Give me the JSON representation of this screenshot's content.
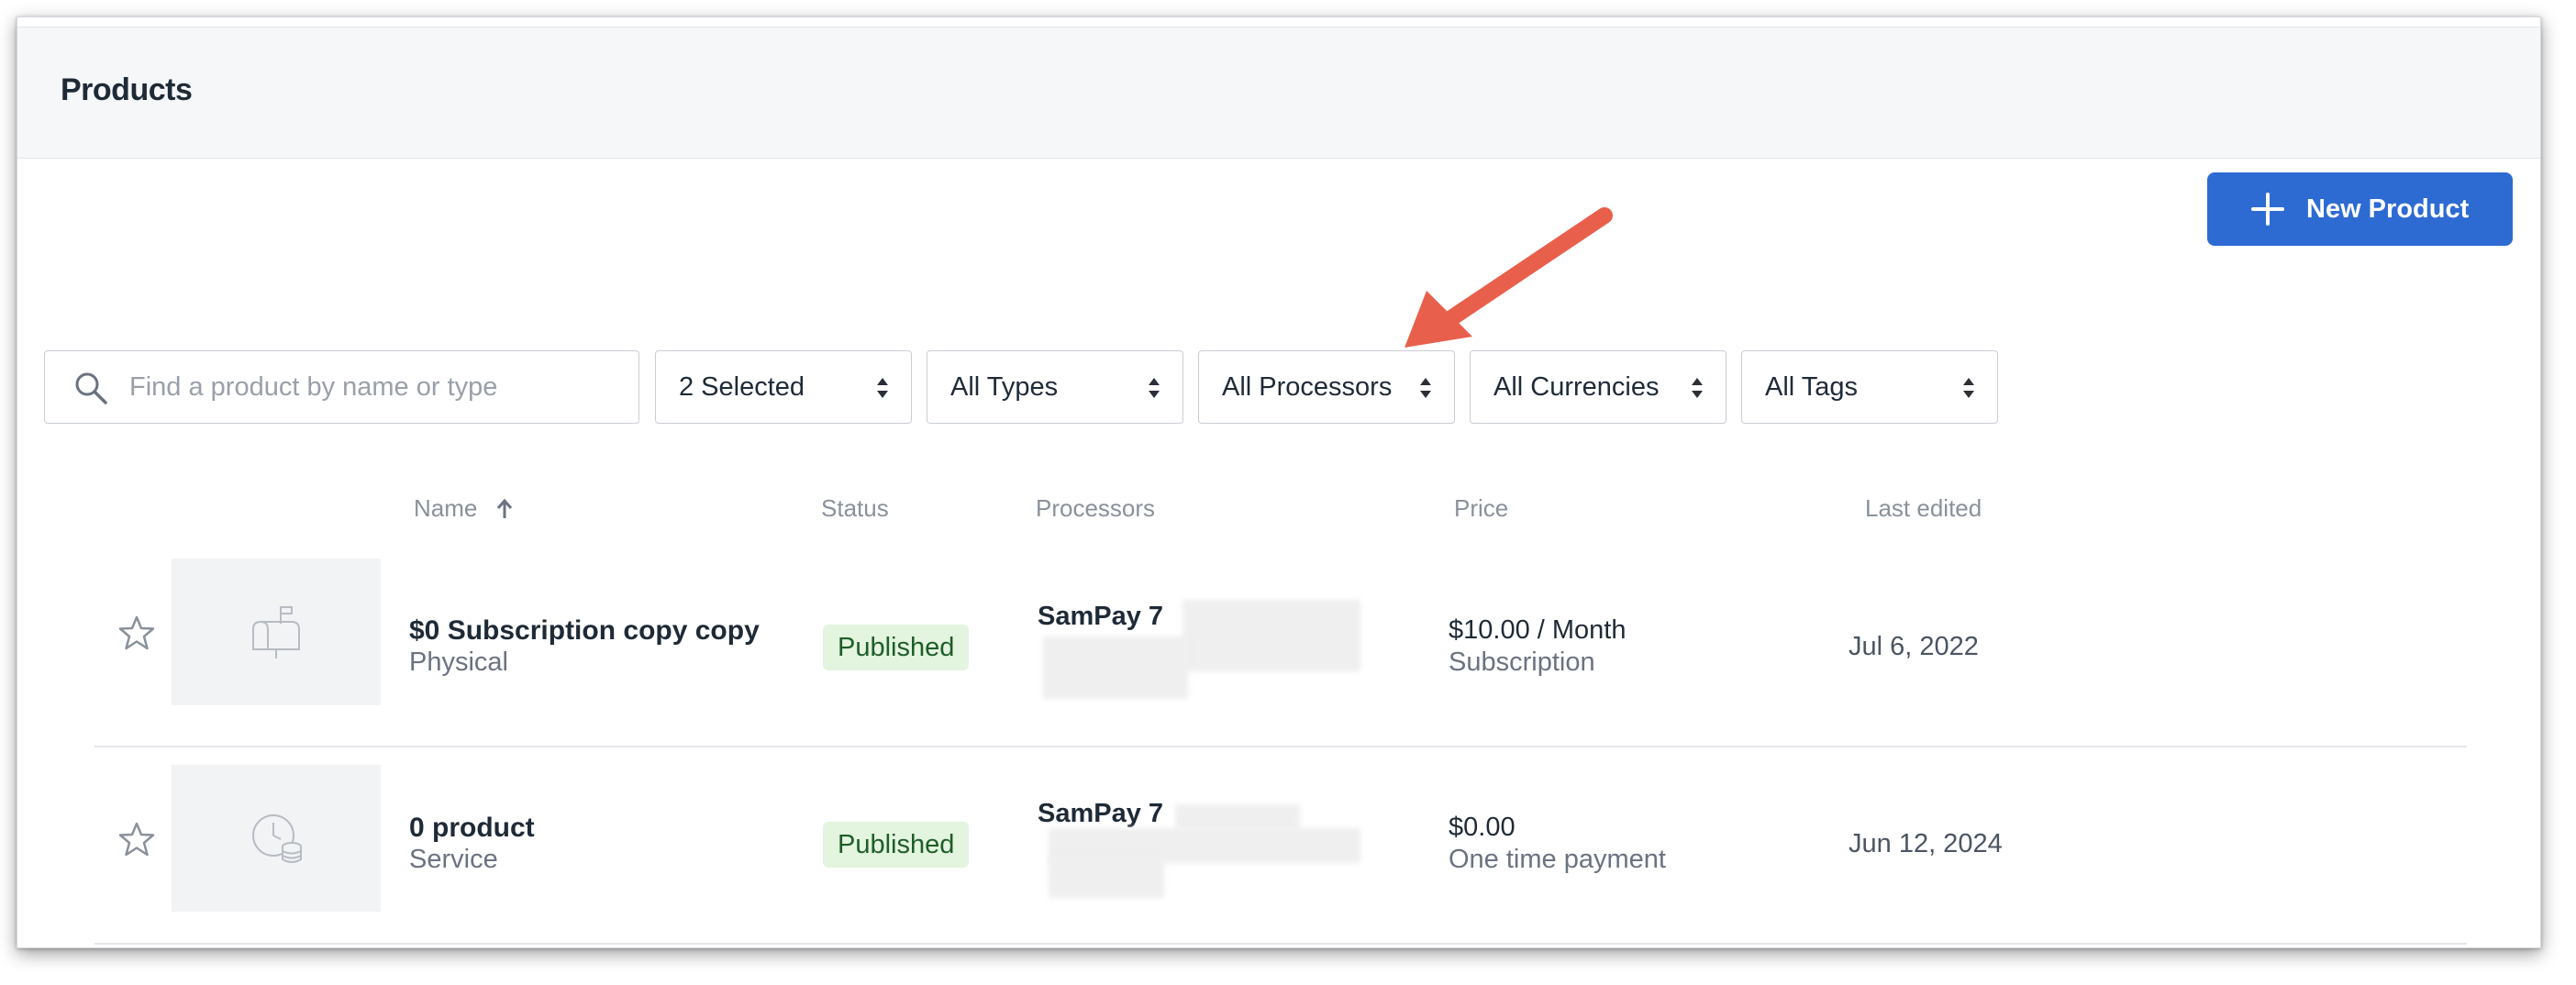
{
  "header": {
    "title": "Products"
  },
  "toolbar": {
    "new_product_label": "New Product"
  },
  "search": {
    "placeholder": "Find a product by name or type",
    "value": ""
  },
  "filters": [
    {
      "label": "2 Selected"
    },
    {
      "label": "All Types"
    },
    {
      "label": "All Processors"
    },
    {
      "label": "All Currencies"
    },
    {
      "label": "All Tags"
    }
  ],
  "table": {
    "columns": {
      "name": "Name",
      "status": "Status",
      "processors": "Processors",
      "price": "Price",
      "last_edited": "Last edited"
    },
    "rows": [
      {
        "name": "$0 Subscription copy copy",
        "type": "Physical",
        "status": "Published",
        "processor": "SamPay 7",
        "price": "$10.00 / Month",
        "price_type": "Subscription",
        "last_edited": "Jul 6, 2022",
        "thumbnail_icon": "mailbox-icon"
      },
      {
        "name": "0 product",
        "type": "Service",
        "status": "Published",
        "processor": "SamPay 7",
        "price": "$0.00",
        "price_type": "One time payment",
        "last_edited": "Jun 12, 2024",
        "thumbnail_icon": "clock-coins-icon"
      }
    ]
  },
  "colors": {
    "primary": "#2d6bd3",
    "published_bg": "#e3f4df",
    "published_text": "#1d5e28",
    "annotation_arrow": "#e8604c"
  }
}
